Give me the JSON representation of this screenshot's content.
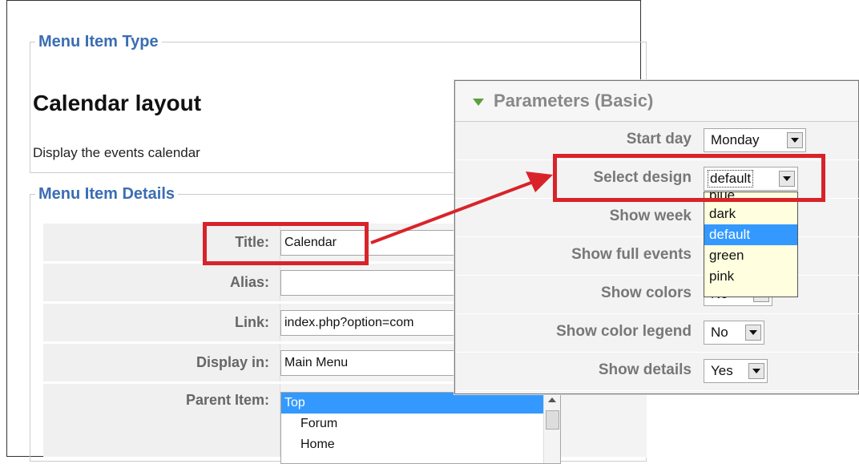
{
  "menu_item_type": {
    "legend": "Menu Item Type",
    "title": "Calendar layout",
    "description": "Display the events calendar"
  },
  "menu_item_details": {
    "legend": "Menu Item Details",
    "fields": {
      "title_label": "Title:",
      "title_value": "Calendar",
      "alias_label": "Alias:",
      "alias_value": "",
      "link_label": "Link:",
      "link_value": "index.php?option=com",
      "display_in_label": "Display in:",
      "display_in_value": "Main Menu",
      "parent_item_label": "Parent Item:"
    },
    "parent_items": [
      "Top",
      "Forum",
      "Home"
    ],
    "parent_selected": "Top"
  },
  "parameters": {
    "title": "Parameters (Basic)",
    "rows": [
      {
        "label": "Start day",
        "value": "Monday"
      },
      {
        "label": "Select design",
        "value": "default"
      },
      {
        "label": "Show week",
        "value": ""
      },
      {
        "label": "Show full events",
        "value": ""
      },
      {
        "label": "Show colors",
        "value": "No"
      },
      {
        "label": "Show color legend",
        "value": "No"
      },
      {
        "label": "Show details",
        "value": "Yes"
      }
    ],
    "design_options": [
      "blue",
      "dark",
      "default",
      "green",
      "pink"
    ],
    "design_selected": "default"
  },
  "colors": {
    "accent": "#3a6db3",
    "highlight": "#3399ff",
    "annotation": "#d8232a",
    "toggle": "#5aa03c"
  }
}
